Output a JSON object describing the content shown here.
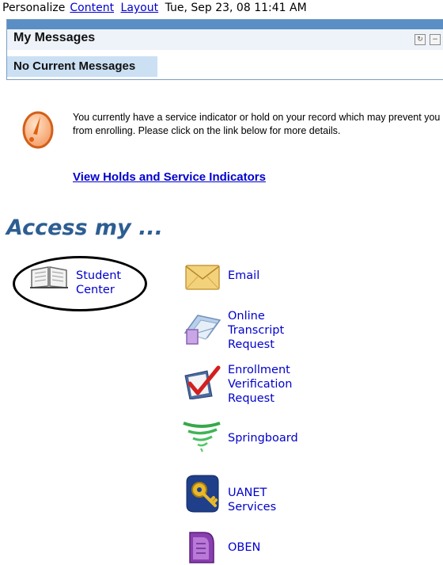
{
  "topbar": {
    "personalize": "Personalize",
    "content_link": "Content",
    "layout_link": "Layout",
    "datetime": "Tue, Sep 23, 08 11:41 AM"
  },
  "messages": {
    "title": "My Messages",
    "empty_text": "No Current Messages"
  },
  "hold": {
    "text": "You currently have a service indicator or hold on your record which may prevent you from enrolling. Please click on the link below for more details.",
    "link": "View Holds and Service Indicators"
  },
  "access": {
    "heading": "Access my ...",
    "tiles": [
      {
        "label_line1": "Student",
        "label_line2": "Center",
        "icon": "book-icon"
      },
      {
        "label_line1": "Email",
        "icon": "envelope-icon"
      },
      {
        "label_line1": "Online",
        "label_line2": "Transcript",
        "label_line3": "Request",
        "icon": "transcript-icon"
      },
      {
        "label_line1": "Enrollment",
        "label_line2": "Verification",
        "label_line3": "Request",
        "icon": "checkmark-icon"
      },
      {
        "label_line1": "Springboard",
        "icon": "springboard-icon"
      },
      {
        "label_line1": "UANET",
        "label_line2": "Services",
        "icon": "key-icon"
      },
      {
        "label_line1": "OBEN",
        "icon": "oben-icon"
      }
    ]
  },
  "colors": {
    "link": "#0000cc",
    "heading": "#2d5e92",
    "header_strip": "#5a8ec5",
    "no_messages_bg": "#cbe0f3"
  }
}
